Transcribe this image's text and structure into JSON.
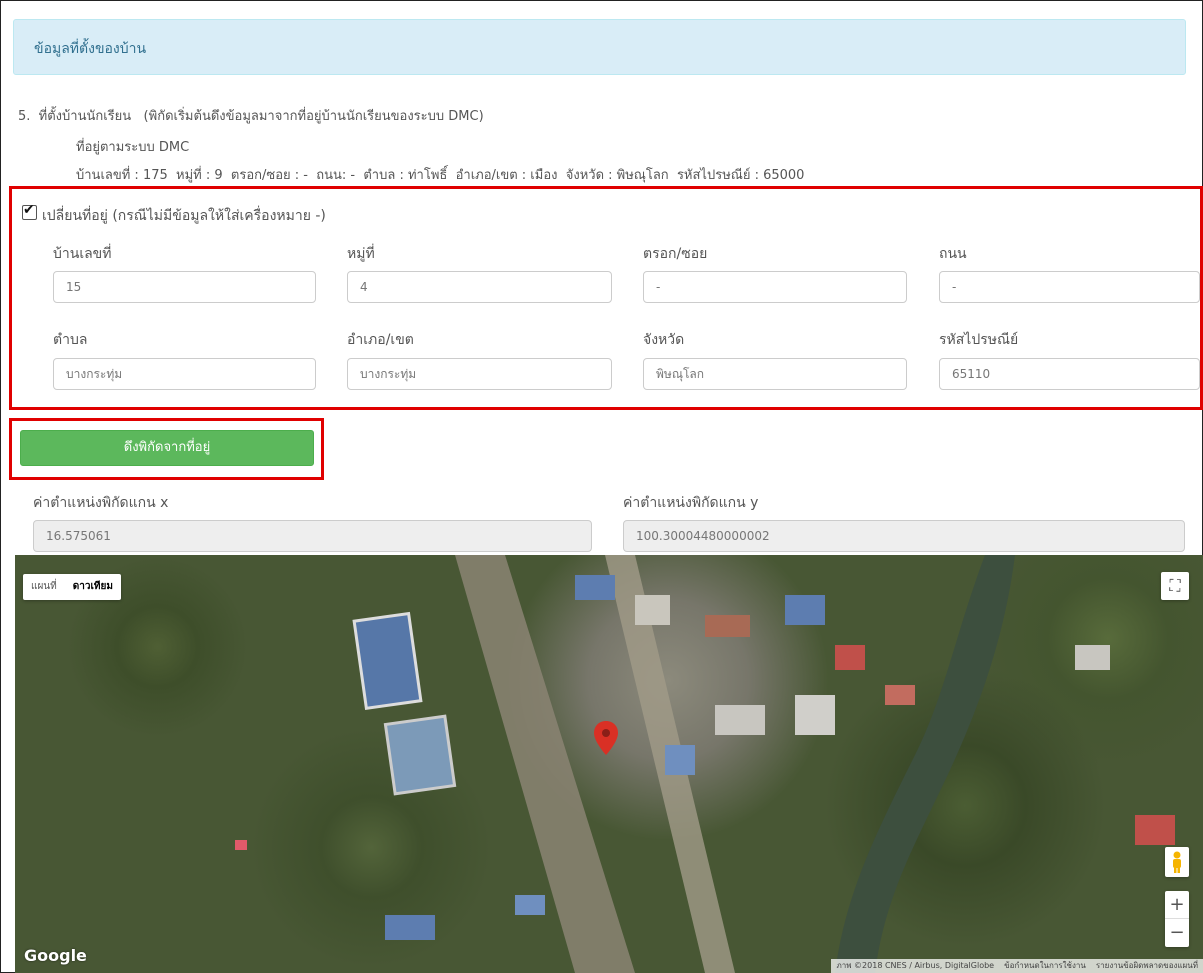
{
  "panel": {
    "title": "ข้อมูลที่ตั้งของบ้าน"
  },
  "location": {
    "heading": "5.  ที่ตั้งบ้านนักเรียน   (พิกัดเริ่มต้นดึงข้อมูลมาจากที่อยู่บ้านนักเรียนของระบบ DMC)",
    "dmc_label": "ที่อยู่ตามระบบ DMC",
    "dmc_address": "บ้านเลขที่ : 175  หมู่ที่ : 9  ตรอก/ซอย : -  ถนน: -  ตำบล : ท่าโพธิ์  อำเภอ/เขต : เมือง  จังหวัด : พิษณุโลก  รหัสไปรษณีย์ : 65000"
  },
  "change_address": {
    "checked": true,
    "label": "เปลี่ยนที่อยู่ (กรณีไม่มีข้อมูลให้ใส่เครื่องหมาย -)",
    "fields": [
      {
        "label": "บ้านเลขที่",
        "value": "15"
      },
      {
        "label": "หมู่ที่",
        "value": "4"
      },
      {
        "label": "ตรอก/ซอย",
        "value": "-"
      },
      {
        "label": "ถนน",
        "value": "-"
      },
      {
        "label": "ตำบล",
        "value": "บางกระทุ่ม"
      },
      {
        "label": "อำเภอ/เขต",
        "value": "บางกระทุ่ม"
      },
      {
        "label": "จังหวัด",
        "value": "พิษณุโลก"
      },
      {
        "label": "รหัสไปรษณีย์",
        "value": "65110"
      }
    ]
  },
  "fetch_button": {
    "label": "ดึงพิกัดจากที่อยู่"
  },
  "coords": {
    "x_label": "ค่าตำแหน่งพิกัดแกน x",
    "x_value": "16.575061",
    "y_label": "ค่าตำแหน่งพิกัดแกน y",
    "y_value": "100.30004480000002"
  },
  "map": {
    "type_map": "แผนที่",
    "type_satellite": "ดาวเทียม",
    "logo": "Google",
    "zoom_in": "+",
    "zoom_out": "−",
    "attribution": "ภาพ ©2018 CNES / Airbus, DigitalGlobe",
    "terms": "ข้อกำหนดในการใช้งาน",
    "report": "รายงานข้อผิดพลาดของแผนที่",
    "marker_color": "#d93025"
  }
}
